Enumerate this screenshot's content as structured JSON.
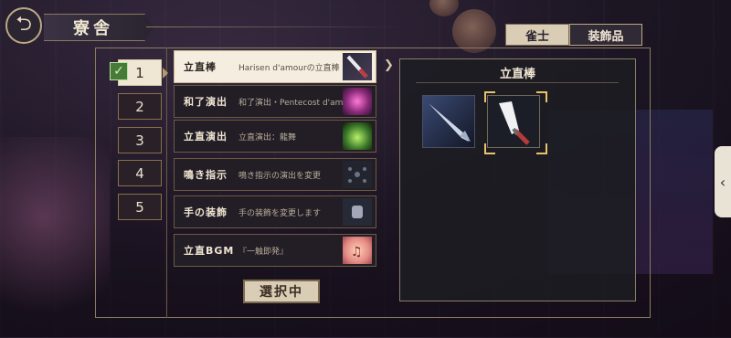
{
  "header": {
    "title": "寮舎",
    "back_icon": "back-arrow-icon"
  },
  "tabs": [
    {
      "label": "雀士",
      "active": false
    },
    {
      "label": "装飾品",
      "active": true
    }
  ],
  "slots": [
    {
      "label": "1",
      "active": true,
      "checked": true
    },
    {
      "label": "2",
      "active": false
    },
    {
      "label": "3",
      "active": false
    },
    {
      "label": "4",
      "active": false
    },
    {
      "label": "5",
      "active": false
    }
  ],
  "categories": [
    {
      "name": "立直棒",
      "desc": "Harisen d'amourの立直棒",
      "icon": "stick-icon",
      "selected": true
    },
    {
      "name": "和了演出",
      "desc": "和了演出・Pentecost d'amour",
      "icon": "pink-effect-icon",
      "selected": false
    },
    {
      "name": "立直演出",
      "desc": "立直演出：龍舞",
      "icon": "green-effect-icon",
      "selected": false
    },
    {
      "name": "鳴き指示",
      "desc": "鳴き指示の演出を変更",
      "icon": "dots-icon",
      "selected": false
    },
    {
      "name": "手の装飾",
      "desc": "手の装飾を変更します",
      "icon": "hand-icon",
      "selected": false
    },
    {
      "name": "立直BGM",
      "desc": "『一触即発』",
      "icon": "music-icon",
      "selected": false
    }
  ],
  "select_button": "選択中",
  "detail": {
    "title": "立直棒",
    "items": [
      {
        "icon": "fish-stick-icon",
        "selected": false
      },
      {
        "icon": "harisen-stick-icon",
        "selected": true
      }
    ]
  },
  "side_handle": "‹"
}
